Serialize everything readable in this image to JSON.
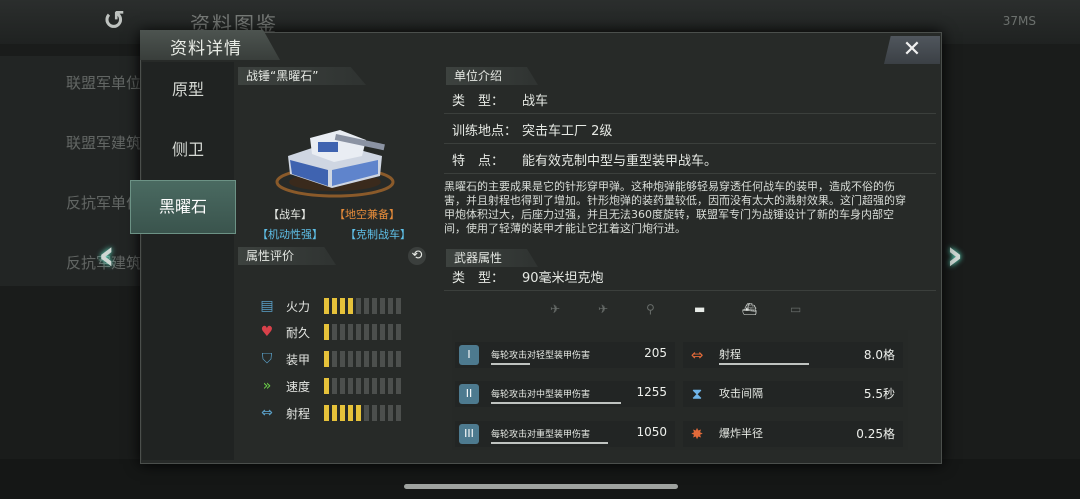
{
  "background": {
    "title": "资料图鉴",
    "status": "37MS",
    "side_items": [
      "联盟军单位",
      "联盟军建筑",
      "反抗军单位",
      "反抗军建筑"
    ]
  },
  "modal": {
    "title": "资料详情",
    "close_label": "✕"
  },
  "tabs": [
    {
      "label": "原型",
      "active": false
    },
    {
      "label": "侧卫",
      "active": false
    },
    {
      "label": "黑曜石",
      "active": true
    }
  ],
  "unit": {
    "name": "战锤“黑曜石”",
    "tags": [
      "【战车】",
      "【地空兼备】",
      "【机动性强】",
      "【克制战车】"
    ],
    "tag_colors": [
      "#e6e9e4",
      "#e58b3a",
      "#5fc0e8",
      "#5fc0e8"
    ]
  },
  "attributes": {
    "header": "属性评价",
    "max": 10,
    "items": [
      {
        "label": "火力",
        "icon": "firepower-icon",
        "level": 4,
        "color": "#5aa0c8"
      },
      {
        "label": "耐久",
        "icon": "heart-icon",
        "level": 1,
        "color": "#d8414a"
      },
      {
        "label": "装甲",
        "icon": "shield-icon",
        "level": 1,
        "color": "#5aa0c8"
      },
      {
        "label": "速度",
        "icon": "speed-icon",
        "level": 1,
        "color": "#6bd048"
      },
      {
        "label": "射程",
        "icon": "range-icon",
        "level": 5,
        "color": "#5aa0c8"
      }
    ]
  },
  "intro": {
    "header": "单位介绍",
    "rows": [
      {
        "k": "类　型：",
        "v": "战车"
      },
      {
        "k": "训练地点：",
        "v": "突击车工厂 2级"
      },
      {
        "k": "特　点：",
        "v": "能有效克制中型与重型装甲战车。"
      }
    ],
    "description": "黑曜石的主要成果是它的针形穿甲弹。这种炮弹能够轻易穿透任何战车的装甲，造成不俗的伤害，并且射程也得到了增加。针形炮弹的装药量较低，因而没有太大的溅射效果。这门超强的穿甲炮体积过大，后座力过强，并且无法360度旋转，联盟军专门为战锤设计了新的车身内部空间，使用了轻薄的装甲才能让它扛着这门炮行进。"
  },
  "weapon": {
    "header": "武器属性",
    "type_k": "类　型：",
    "type_v": "90毫米坦克炮",
    "targets": [
      {
        "icon": "jet-icon",
        "glyph": "✈",
        "active": false
      },
      {
        "icon": "plane-icon",
        "glyph": "✈",
        "active": false
      },
      {
        "icon": "helicopter-icon",
        "glyph": "⚲",
        "active": false
      },
      {
        "icon": "tank-icon",
        "glyph": "▬",
        "active": true
      },
      {
        "icon": "ship-icon",
        "glyph": "⛴",
        "active": true
      },
      {
        "icon": "submarine-icon",
        "glyph": "▭",
        "active": false
      }
    ],
    "stats_left": [
      {
        "label": "每轮攻击对轻型装甲伤害",
        "value": "205",
        "icon": "light-armor-icon",
        "glyph": "I",
        "fill": 0.3
      },
      {
        "label": "每轮攻击对中型装甲伤害",
        "value": "1255",
        "icon": "medium-armor-icon",
        "glyph": "II",
        "fill": 1.0
      },
      {
        "label": "每轮攻击对重型装甲伤害",
        "value": "1050",
        "icon": "heavy-armor-icon",
        "glyph": "III",
        "fill": 0.9
      }
    ],
    "stats_right": [
      {
        "label": "射程",
        "value": "8.0格",
        "icon": "range-icon",
        "glyph": "⇔"
      },
      {
        "label": "攻击间隔",
        "value": "5.5秒",
        "icon": "hourglass-icon",
        "glyph": "⧗"
      },
      {
        "label": "爆炸半径",
        "value": "0.25格",
        "icon": "blast-icon",
        "glyph": "✸"
      }
    ]
  }
}
